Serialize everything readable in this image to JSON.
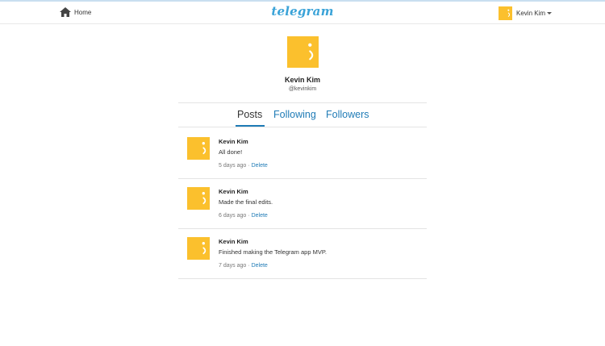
{
  "nav": {
    "home_label": "Home",
    "brand": "telegram",
    "user_name": "Kevin Kim"
  },
  "profile": {
    "name": "Kevin Kim",
    "handle": "@kevinkim"
  },
  "tabs": [
    {
      "label": "Posts",
      "active": true
    },
    {
      "label": "Following",
      "active": false
    },
    {
      "label": "Followers",
      "active": false
    }
  ],
  "posts": [
    {
      "author": "Kevin Kim",
      "text": "All done!",
      "time": "5 days ago",
      "delete_label": "Delete"
    },
    {
      "author": "Kevin Kim",
      "text": "Made the final edits.",
      "time": "6 days ago",
      "delete_label": "Delete"
    },
    {
      "author": "Kevin Kim",
      "text": "Finished making the Telegram app MVP.",
      "time": "7 days ago",
      "delete_label": "Delete"
    }
  ],
  "colors": {
    "brand": "#3aa3d8",
    "link": "#1f7bb6",
    "avatar_bg": "#fbc02d"
  },
  "icons": {
    "home": "home-icon",
    "avatar": "smiley-avatar-icon",
    "caret": "caret-down-icon"
  }
}
